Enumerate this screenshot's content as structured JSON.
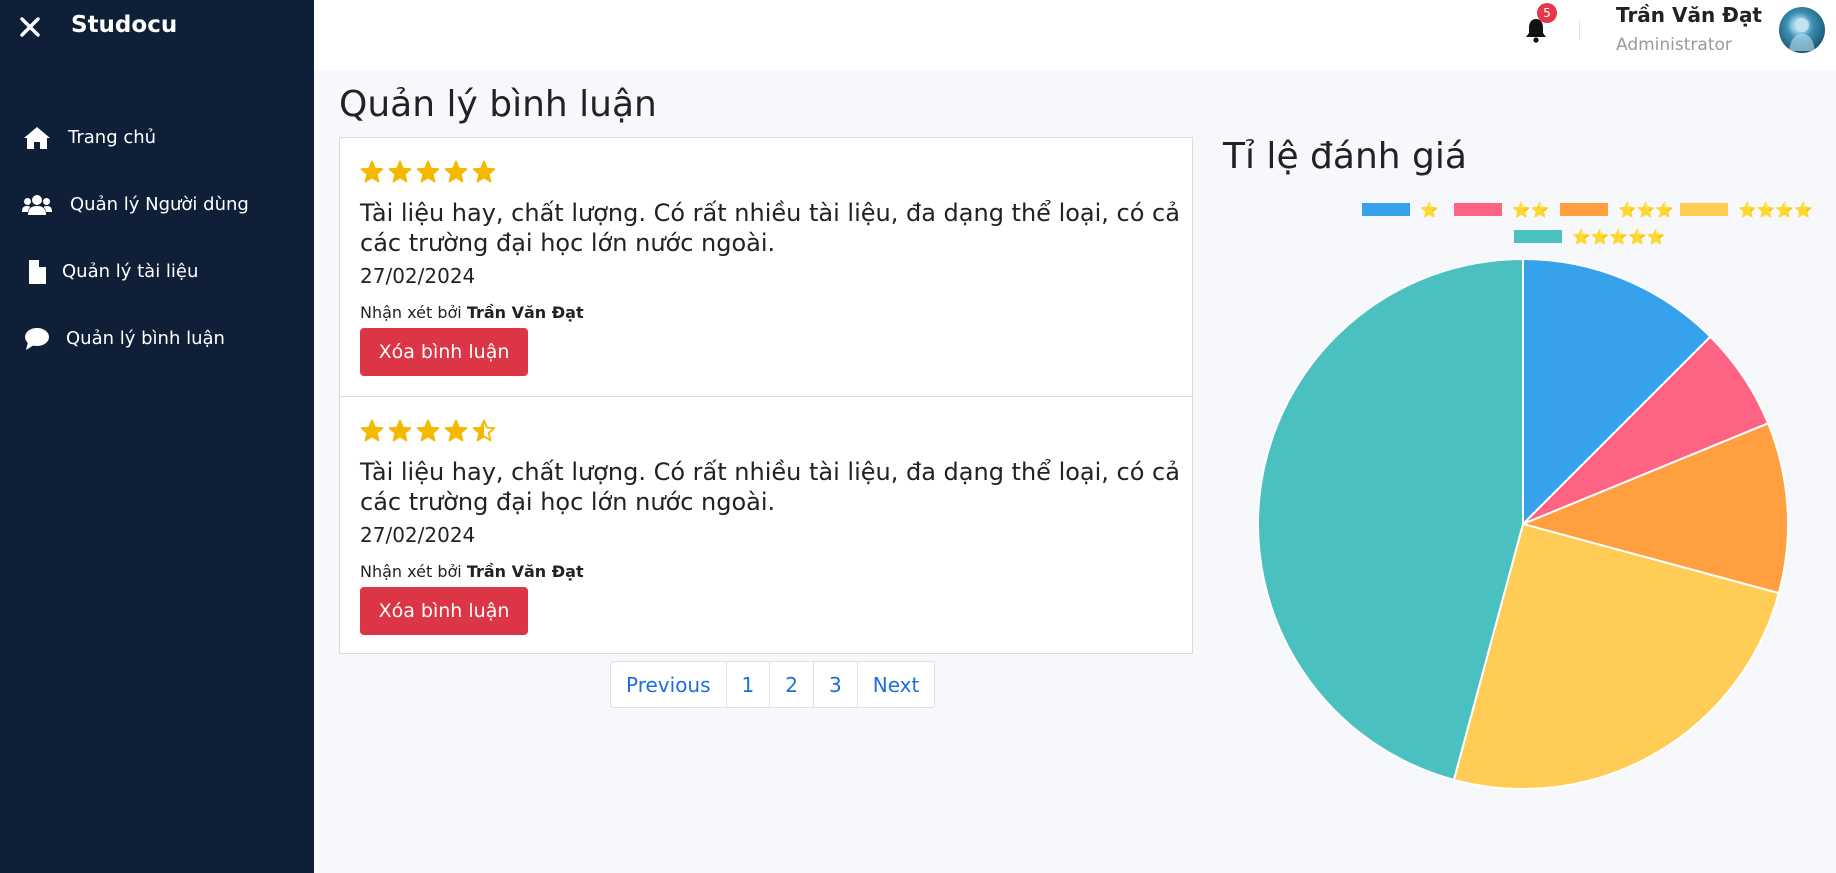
{
  "app": {
    "brand": "Studocu"
  },
  "sidebar": {
    "items": [
      {
        "label": "Trang chủ",
        "icon": "home-icon"
      },
      {
        "label": "Quản lý Người dùng",
        "icon": "users-icon"
      },
      {
        "label": "Quản lý tài liệu",
        "icon": "document-icon"
      },
      {
        "label": "Quản lý bình luận",
        "icon": "comment-icon"
      }
    ]
  },
  "header": {
    "notification_count": "5",
    "user_name": "Trần Văn Đạt",
    "user_role": "Administrator"
  },
  "main": {
    "title": "Quản lý bình luận",
    "reviewer_prefix": "Nhận xét bởi",
    "delete_label": "Xóa bình luận",
    "comments": [
      {
        "rating": 5,
        "text": "Tài liệu hay, chất lượng. Có rất nhiều tài liệu, đa dạng thể loại, có cả các trường đại học lớn nước ngoài.",
        "date": "27/02/2024",
        "author": "Trần Văn Đạt"
      },
      {
        "rating": 4.5,
        "text": "Tài liệu hay, chất lượng. Có rất nhiều tài liệu, đa dạng thể loại, có cả các trường đại học lớn nước ngoài.",
        "date": "27/02/2024",
        "author": "Trần Văn Đạt"
      }
    ],
    "pagination": {
      "previous": "Previous",
      "pages": [
        "1",
        "2",
        "3"
      ],
      "next": "Next"
    }
  },
  "colors": {
    "star": "#f5b800",
    "delete": "#dc3545",
    "link": "#1a6fe0",
    "sidebar_bg": "#0f1f38"
  },
  "chart_data": {
    "type": "pie",
    "title": "Tỉ lệ đánh giá",
    "legend_position": "top-center",
    "series": [
      {
        "name": "⭐",
        "value": 12.5,
        "color": "#36a2eb"
      },
      {
        "name": "⭐⭐",
        "value": 6.3,
        "color": "#ff6384"
      },
      {
        "name": "⭐⭐⭐",
        "value": 10.4,
        "color": "#ff9f40"
      },
      {
        "name": "⭐⭐⭐⭐",
        "value": 25.0,
        "color": "#ffcd56"
      },
      {
        "name": "⭐⭐⭐⭐⭐",
        "value": 45.8,
        "color": "#4bc0c0"
      }
    ]
  }
}
